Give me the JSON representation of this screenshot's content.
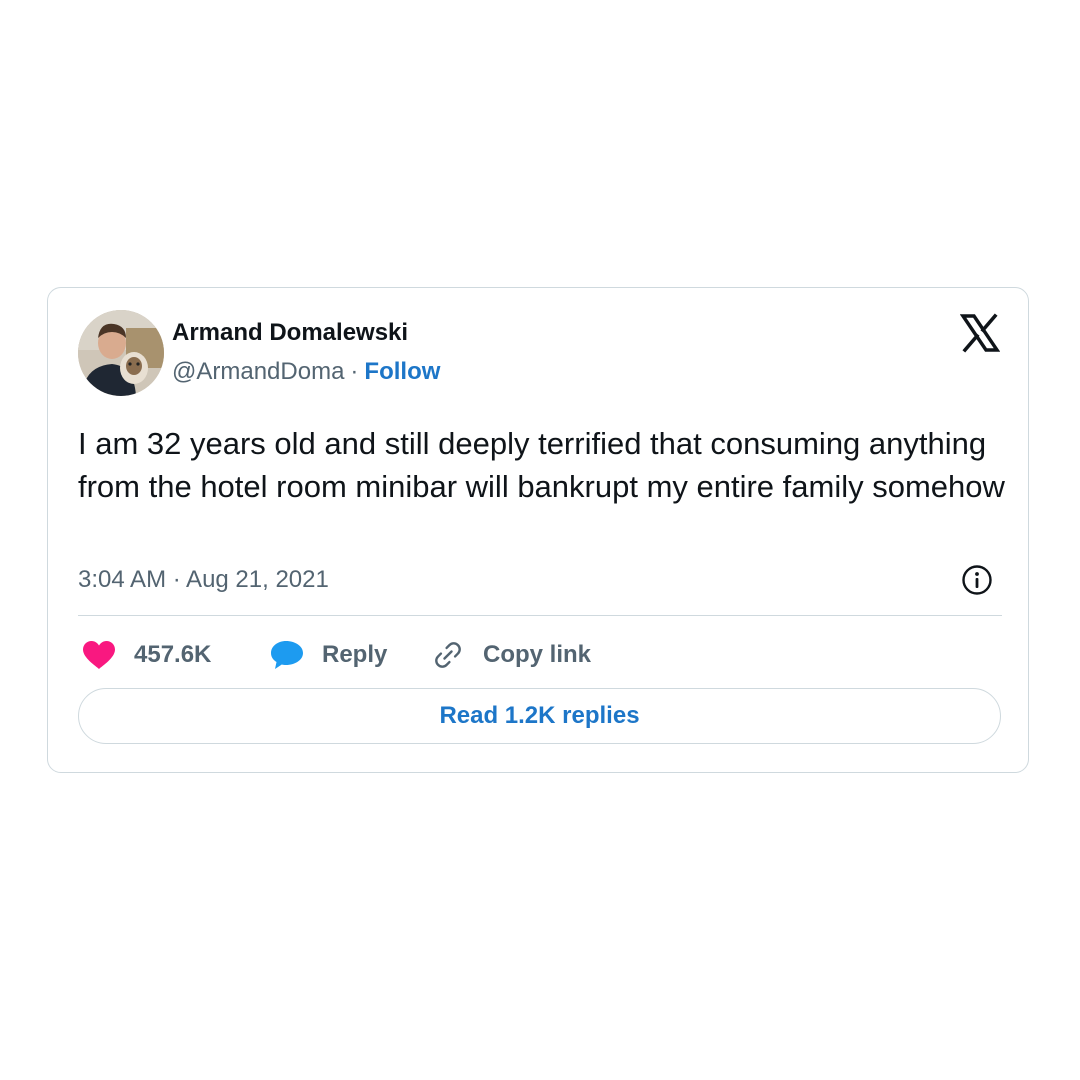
{
  "author": {
    "name": "Armand Domalewski",
    "handle": "@ArmandDoma",
    "separator": "·",
    "follow_label": "Follow"
  },
  "tweet": {
    "text": "I am 32 years old and still deeply terrified that consuming anything from the hotel room minibar will bankrupt my entire family somehow",
    "timestamp": "3:04 AM · Aug 21, 2021"
  },
  "actions": {
    "like_count": "457.6K",
    "reply_label": "Reply",
    "copy_link_label": "Copy link"
  },
  "read_replies_label": "Read 1.2K replies",
  "icons": {
    "brand": "x-logo-icon",
    "info": "info-icon",
    "like": "heart-icon",
    "reply": "speech-bubble-icon",
    "copy": "link-icon"
  },
  "colors": {
    "like": "#f91880",
    "reply": "#1d9bf0",
    "link": "#1d76c8",
    "muted": "#536471",
    "border": "#cfd9de"
  }
}
